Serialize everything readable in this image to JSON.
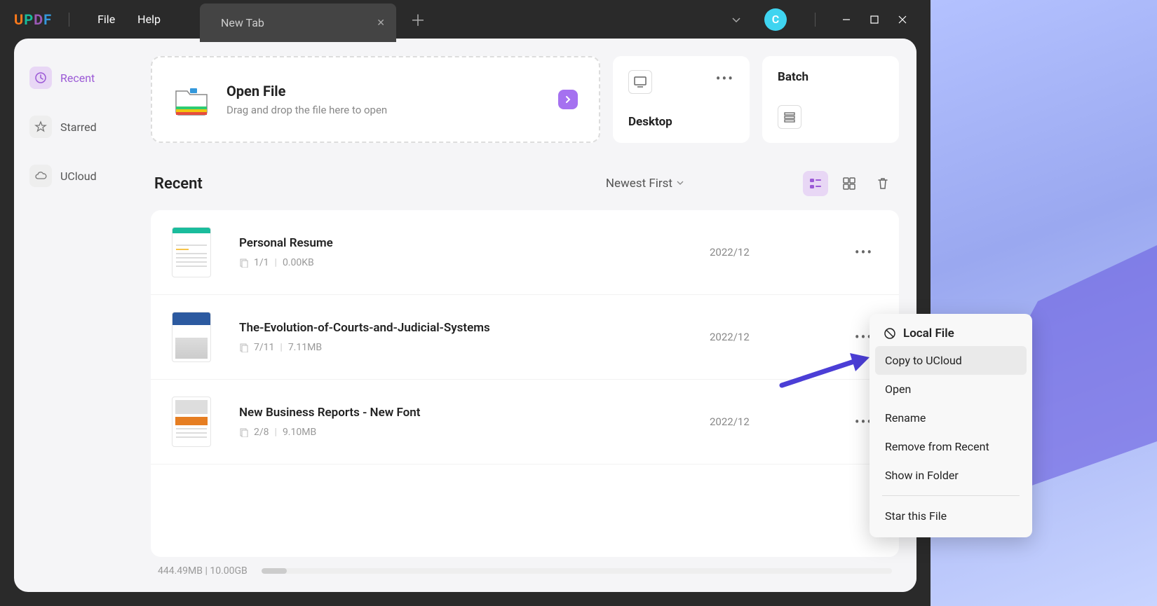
{
  "logo_letters": {
    "u": "U",
    "p": "P",
    "d": "D",
    "f": "F"
  },
  "menu": {
    "file": "File",
    "help": "Help"
  },
  "tab": {
    "title": "New Tab"
  },
  "avatar_letter": "C",
  "sidebar": {
    "recent": "Recent",
    "starred": "Starred",
    "ucloud": "UCloud"
  },
  "open_card": {
    "title": "Open File",
    "sub": "Drag and drop the file here to open"
  },
  "cards": {
    "desktop": "Desktop",
    "batch": "Batch"
  },
  "section": {
    "title": "Recent",
    "sort": "Newest First"
  },
  "files": [
    {
      "name": "Personal Resume",
      "pages": "1/1",
      "size": "0.00KB",
      "date": "2022/12"
    },
    {
      "name": "The-Evolution-of-Courts-and-Judicial-Systems",
      "pages": "7/11",
      "size": "7.11MB",
      "date": "2022/12"
    },
    {
      "name": "New Business Reports - New Font",
      "pages": "2/8",
      "size": "9.10MB",
      "date": "2022/12"
    }
  ],
  "storage": {
    "used": "444.49MB",
    "total": "10.00GB"
  },
  "context": {
    "header": "Local File",
    "copy": "Copy to UCloud",
    "open": "Open",
    "rename": "Rename",
    "remove": "Remove from Recent",
    "show": "Show in Folder",
    "star": "Star this File"
  }
}
